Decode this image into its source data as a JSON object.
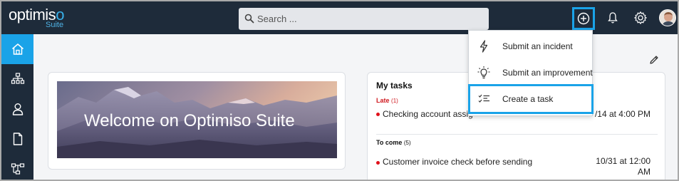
{
  "app": {
    "logo_main": "optimis",
    "logo_accent": "o",
    "logo_sub": "Suite"
  },
  "search": {
    "placeholder": "Search ..."
  },
  "header": {
    "add_icon": "plus-circle-icon",
    "notifications_icon": "bell-icon",
    "settings_icon": "gear-icon"
  },
  "sidebar": {
    "items": [
      {
        "icon": "home-icon",
        "active": true
      },
      {
        "icon": "org-chart-icon",
        "active": false
      },
      {
        "icon": "user-icon",
        "active": false
      },
      {
        "icon": "document-icon",
        "active": false
      },
      {
        "icon": "process-icon",
        "active": false
      }
    ]
  },
  "welcome": {
    "text": "Welcome on Optimiso Suite"
  },
  "tasks": {
    "title": "My tasks",
    "late_label": "Late",
    "late_count": "(1)",
    "late_items": [
      {
        "name": "Checking account assig",
        "date": "/14 at 4:00 PM"
      }
    ],
    "tocome_label": "To come",
    "tocome_count": "(5)",
    "tocome_items": [
      {
        "name": "Customer invoice check before sending",
        "date": "10/31 at 12:00 AM"
      }
    ]
  },
  "dropdown": {
    "items": [
      {
        "label": "Submit an incident",
        "icon": "lightning-icon"
      },
      {
        "label": "Submit an improvement",
        "icon": "lightbulb-icon"
      },
      {
        "label": "Create a task",
        "icon": "checklist-icon"
      }
    ]
  },
  "colors": {
    "topbar": "#1e2b3a",
    "accent": "#1aa3e8",
    "late": "#d0191f"
  }
}
